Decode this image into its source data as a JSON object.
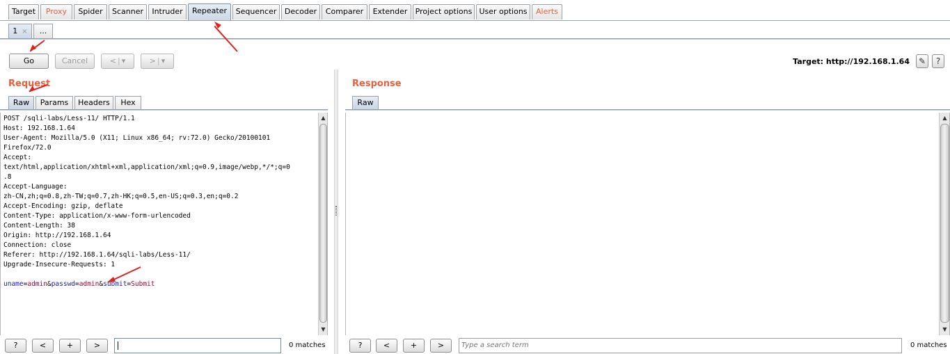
{
  "top_tabs": [
    {
      "label": "Target"
    },
    {
      "label": "Proxy"
    },
    {
      "label": "Spider"
    },
    {
      "label": "Scanner"
    },
    {
      "label": "Intruder"
    },
    {
      "label": "Repeater"
    },
    {
      "label": "Sequencer"
    },
    {
      "label": "Decoder"
    },
    {
      "label": "Comparer"
    },
    {
      "label": "Extender"
    },
    {
      "label": "Project options"
    },
    {
      "label": "User options"
    },
    {
      "label": "Alerts"
    }
  ],
  "repeater_tabs": [
    {
      "label": "1",
      "close": "×"
    },
    {
      "label": "..."
    }
  ],
  "toolbar": {
    "go_label": "Go",
    "cancel_label": "Cancel",
    "back_label": "<",
    "forward_label": ">",
    "dropdown_glyph": "▾",
    "target_text": "Target: http://192.168.1.64",
    "edit_glyph": "✎",
    "help_glyph": "?"
  },
  "request": {
    "title": "Request",
    "tabs": [
      "Raw",
      "Params",
      "Headers",
      "Hex"
    ],
    "lines": [
      "POST /sqli-labs/Less-11/ HTTP/1.1",
      "Host: 192.168.1.64",
      "User-Agent: Mozilla/5.0 (X11; Linux x86_64; rv:72.0) Gecko/20100101",
      "Firefox/72.0",
      "Accept:",
      "text/html,application/xhtml+xml,application/xml;q=0.9,image/webp,*/*;q=0",
      ".8",
      "Accept-Language:",
      "zh-CN,zh;q=0.8,zh-TW;q=0.7,zh-HK;q=0.5,en-US;q=0.3,en;q=0.2",
      "Accept-Encoding: gzip, deflate",
      "Content-Type: application/x-www-form-urlencoded",
      "Content-Length: 38",
      "Origin: http://192.168.1.64",
      "Connection: close",
      "Referer: http://192.168.1.64/sqli-labs/Less-11/",
      "Upgrade-Insecure-Requests: 1",
      ""
    ],
    "body_params": [
      {
        "name": "uname",
        "value": "admin"
      },
      {
        "name": "passwd",
        "value": "admin"
      },
      {
        "name": "submit",
        "value": "Submit"
      }
    ],
    "eq": "=",
    "amp": "&",
    "search_placeholder": "",
    "matches": "0 matches"
  },
  "response": {
    "title": "Response",
    "tabs": [
      "Raw"
    ],
    "search_placeholder": "Type a search term",
    "matches": "0 matches"
  },
  "search_buttons": {
    "help": "?",
    "prev": "<",
    "add": "+",
    "next": ">"
  },
  "colors": {
    "accent": "#e8603c",
    "annotation": "#e0201c",
    "param_name": "#1a1aa8",
    "param_value": "#a4003a"
  }
}
